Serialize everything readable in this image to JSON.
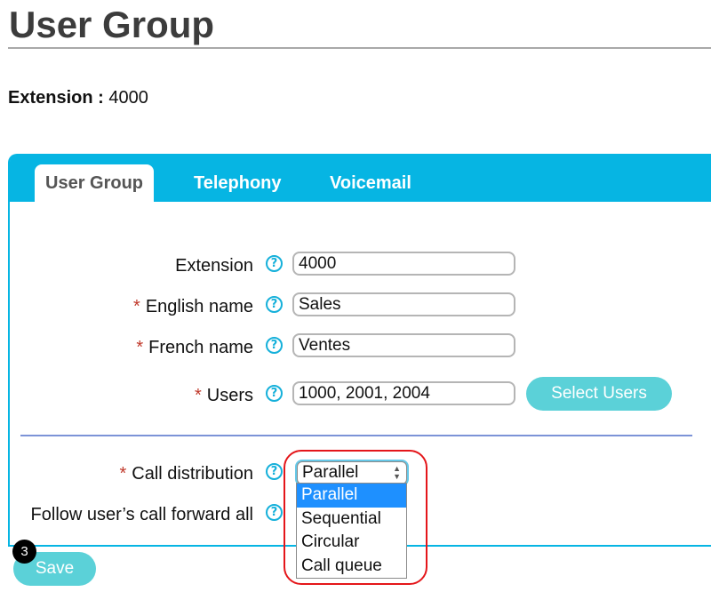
{
  "page": {
    "title": "User Group",
    "extension_label": "Extension :",
    "extension_value": "4000"
  },
  "tabs": [
    {
      "label": "User Group",
      "active": true
    },
    {
      "label": "Telephony",
      "active": false
    },
    {
      "label": "Voicemail",
      "active": false
    }
  ],
  "form": {
    "extension": {
      "label": "Extension",
      "value": "4000",
      "required": false
    },
    "english_name": {
      "label": "English name",
      "value": "Sales",
      "required": true
    },
    "french_name": {
      "label": "French name",
      "value": "Ventes",
      "required": true
    },
    "users": {
      "label": "Users",
      "value": "1000, 2001, 2004",
      "required": true
    },
    "select_users_label": "Select Users",
    "call_distribution": {
      "label": "Call distribution",
      "required": true,
      "selected": "Parallel",
      "options": [
        "Parallel",
        "Sequential",
        "Circular",
        "Call queue"
      ]
    },
    "follow_forward": {
      "label": "Follow user’s call forward all"
    },
    "help_glyph": "?",
    "required_marker": "*"
  },
  "actions": {
    "save_label": "Save",
    "step_badge": "3"
  },
  "colors": {
    "accent": "#06b5e3",
    "button": "#5bd1d8",
    "highlight": "#e4161a",
    "selected_option": "#1e90ff"
  }
}
